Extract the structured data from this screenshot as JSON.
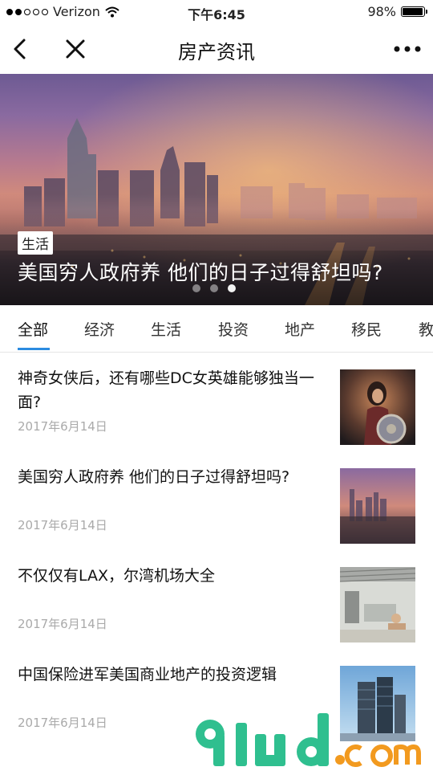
{
  "status_bar": {
    "carrier": "Verizon",
    "time": "下午6:45",
    "battery": "98%"
  },
  "nav": {
    "title": "房产资讯"
  },
  "hero": {
    "tag": "生活",
    "title": "美国穷人政府养 他们的日子过得舒坦吗?",
    "page_count": 3,
    "active_page": 3
  },
  "tabs": [
    "全部",
    "经济",
    "生活",
    "投资",
    "地产",
    "移民",
    "教"
  ],
  "articles": [
    {
      "title": "神奇女侠后，还有哪些DC女英雄能够独当一面?",
      "date": "2017年6月14日"
    },
    {
      "title": "美国穷人政府养 他们的日子过得舒坦吗?",
      "date": "2017年6月14日"
    },
    {
      "title": "不仅仅有LAX，尔湾机场大全",
      "date": "2017年6月14日"
    },
    {
      "title": "中国保险进军美国商业地产的投资逻辑",
      "date": "2017年6月14日"
    }
  ],
  "watermark": {
    "text": "91ud.com"
  },
  "colors": {
    "accent": "#2b8be0",
    "watermark_green": "#2fbf8f",
    "watermark_orange": "#f29a1f"
  }
}
